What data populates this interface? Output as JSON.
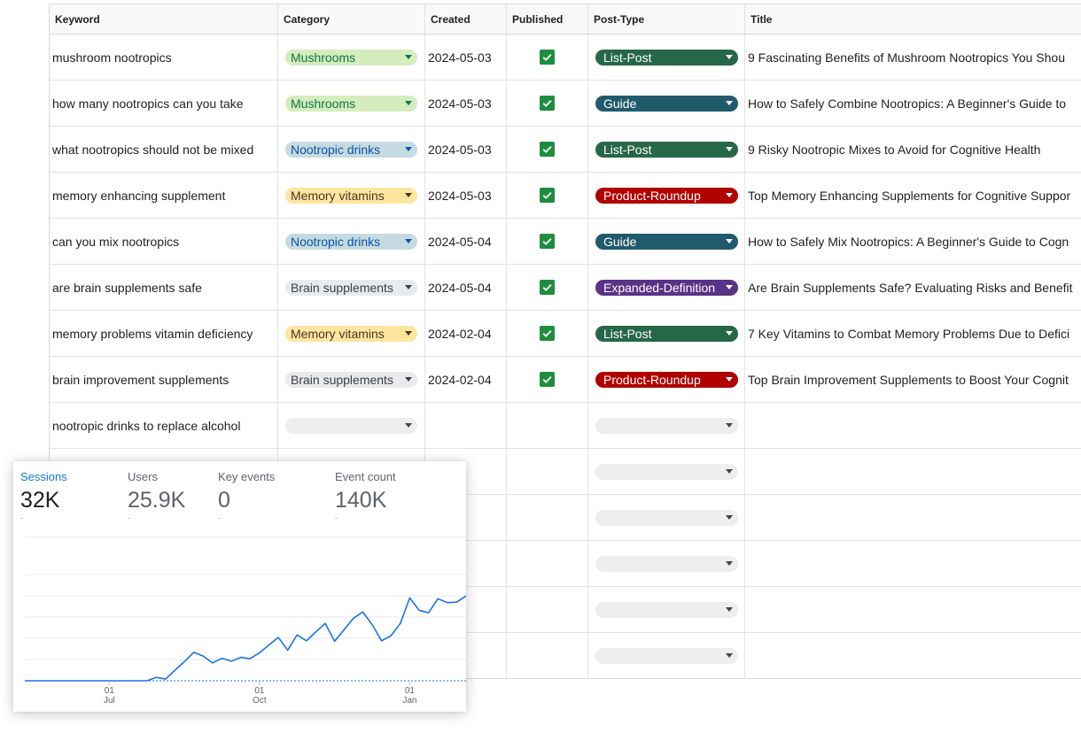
{
  "sheet": {
    "columns": [
      "Keyword",
      "Category",
      "Created",
      "Published",
      "Post-Type",
      "Title"
    ],
    "rows": [
      {
        "keyword": "mushroom nootropics",
        "category": "Mushrooms",
        "created": "2024-05-03",
        "published": true,
        "post_type": "List-Post",
        "title": "9 Fascinating Benefits of Mushroom Nootropics You Shou"
      },
      {
        "keyword": "how many nootropics can you take",
        "category": "Mushrooms",
        "created": "2024-05-03",
        "published": true,
        "post_type": "Guide",
        "title": "How to Safely Combine Nootropics: A Beginner's Guide to"
      },
      {
        "keyword": "what nootropics should not be mixed",
        "category": "Nootropic drinks",
        "created": "2024-05-03",
        "published": true,
        "post_type": "List-Post",
        "title": "9 Risky Nootropic Mixes to Avoid for Cognitive Health"
      },
      {
        "keyword": "memory enhancing supplement",
        "category": "Memory vitamins",
        "created": "2024-05-03",
        "published": true,
        "post_type": "Product-Roundup",
        "title": "Top Memory Enhancing Supplements for Cognitive Suppor"
      },
      {
        "keyword": "can you mix nootropics",
        "category": "Nootropic drinks",
        "created": "2024-05-04",
        "published": true,
        "post_type": "Guide",
        "title": "How to Safely Mix Nootropics: A Beginner's Guide to Cogn"
      },
      {
        "keyword": "are brain supplements safe",
        "category": "Brain supplements",
        "created": "2024-05-04",
        "published": true,
        "post_type": "Expanded-Definition",
        "title": "Are Brain Supplements Safe? Evaluating Risks and Benefit"
      },
      {
        "keyword": "memory problems vitamin deficiency",
        "category": "Memory vitamins",
        "created": "2024-02-04",
        "published": true,
        "post_type": "List-Post",
        "title": "7 Key Vitamins to Combat Memory Problems Due to Defici"
      },
      {
        "keyword": "brain improvement supplements",
        "category": "Brain supplements",
        "created": "2024-02-04",
        "published": true,
        "post_type": "Product-Roundup",
        "title": "Top Brain Improvement Supplements to Boost Your Cognit"
      },
      {
        "keyword": "nootropic drinks to replace alcohol",
        "category": "",
        "created": "",
        "published": false,
        "post_type": "",
        "title": ""
      },
      {
        "keyword": "",
        "category": "",
        "created": "",
        "published": false,
        "post_type": "",
        "title": ""
      },
      {
        "keyword": "",
        "category": "",
        "created": "",
        "published": false,
        "post_type": "",
        "title": ""
      },
      {
        "keyword": "",
        "category": "",
        "created": "",
        "published": false,
        "post_type": "",
        "title": ""
      },
      {
        "keyword": "",
        "category": "",
        "created": "",
        "published": false,
        "post_type": "",
        "title": ""
      },
      {
        "keyword": "",
        "category": "",
        "created": "",
        "published": false,
        "post_type": "",
        "title": ""
      }
    ],
    "category_colors": {
      "Mushrooms": {
        "bg": "#d4edbc",
        "fg": "#11734b"
      },
      "Nootropic drinks": {
        "bg": "#c6dbe1",
        "fg": "#0a53a8"
      },
      "Memory vitamins": {
        "bg": "#ffe5a0",
        "fg": "#473821"
      },
      "Brain supplements": {
        "bg": "#e8eaed",
        "fg": "#3c4043"
      }
    },
    "post_type_colors": {
      "List-Post": {
        "bg": "#276749",
        "fg": "#ffffff"
      },
      "Guide": {
        "bg": "#215a6c",
        "fg": "#ffffff"
      },
      "Product-Roundup": {
        "bg": "#b10202",
        "fg": "#ffffff"
      },
      "Expanded-Definition": {
        "bg": "#5a3286",
        "fg": "#ffffff"
      }
    }
  },
  "analytics": {
    "metrics": [
      {
        "label": "Sessions",
        "value": "32K",
        "change": "-",
        "active": true
      },
      {
        "label": "Users",
        "value": "25.9K",
        "change": "-",
        "active": false
      },
      {
        "label": "Key events",
        "value": "0",
        "change": "-",
        "active": false
      },
      {
        "label": "Event count",
        "value": "140K",
        "change": "-",
        "active": false
      }
    ],
    "accent_color": "#1a73e8"
  },
  "chart_data": {
    "type": "line",
    "x_ticks": [
      {
        "day": "01",
        "month": "Jul"
      },
      {
        "day": "01",
        "month": "Oct"
      },
      {
        "day": "01",
        "month": "Jan"
      }
    ],
    "series": [
      {
        "values": [
          0,
          0,
          0,
          0,
          0,
          0,
          0,
          0,
          0,
          0,
          0,
          0,
          0,
          0,
          0.8,
          0.4,
          2.5,
          4.5,
          6.7,
          5.8,
          4.2,
          5.3,
          4.6,
          5.5,
          5.2,
          6.6,
          8.4,
          10.2,
          7.2,
          10.8,
          9.4,
          11.5,
          13.5,
          9.3,
          12.0,
          14.7,
          16.2,
          13.2,
          9.4,
          10.6,
          13.5,
          19.5,
          16.6,
          16.0,
          19.3,
          18.4,
          18.5,
          20.0
        ]
      },
      {
        "style": "dashed",
        "values": [
          0,
          0,
          0,
          0,
          0,
          0,
          0,
          0,
          0,
          0,
          0,
          0,
          0,
          0,
          0,
          0,
          0,
          0,
          0,
          0,
          0,
          0,
          0,
          0,
          0,
          0,
          0,
          0,
          0,
          0,
          0,
          0,
          0,
          0,
          0,
          0,
          0,
          0,
          0,
          0,
          0,
          0,
          0,
          0,
          0,
          0,
          0,
          0
        ]
      }
    ],
    "ylim": [
      0,
      25
    ],
    "grid": true,
    "legend": "none"
  }
}
